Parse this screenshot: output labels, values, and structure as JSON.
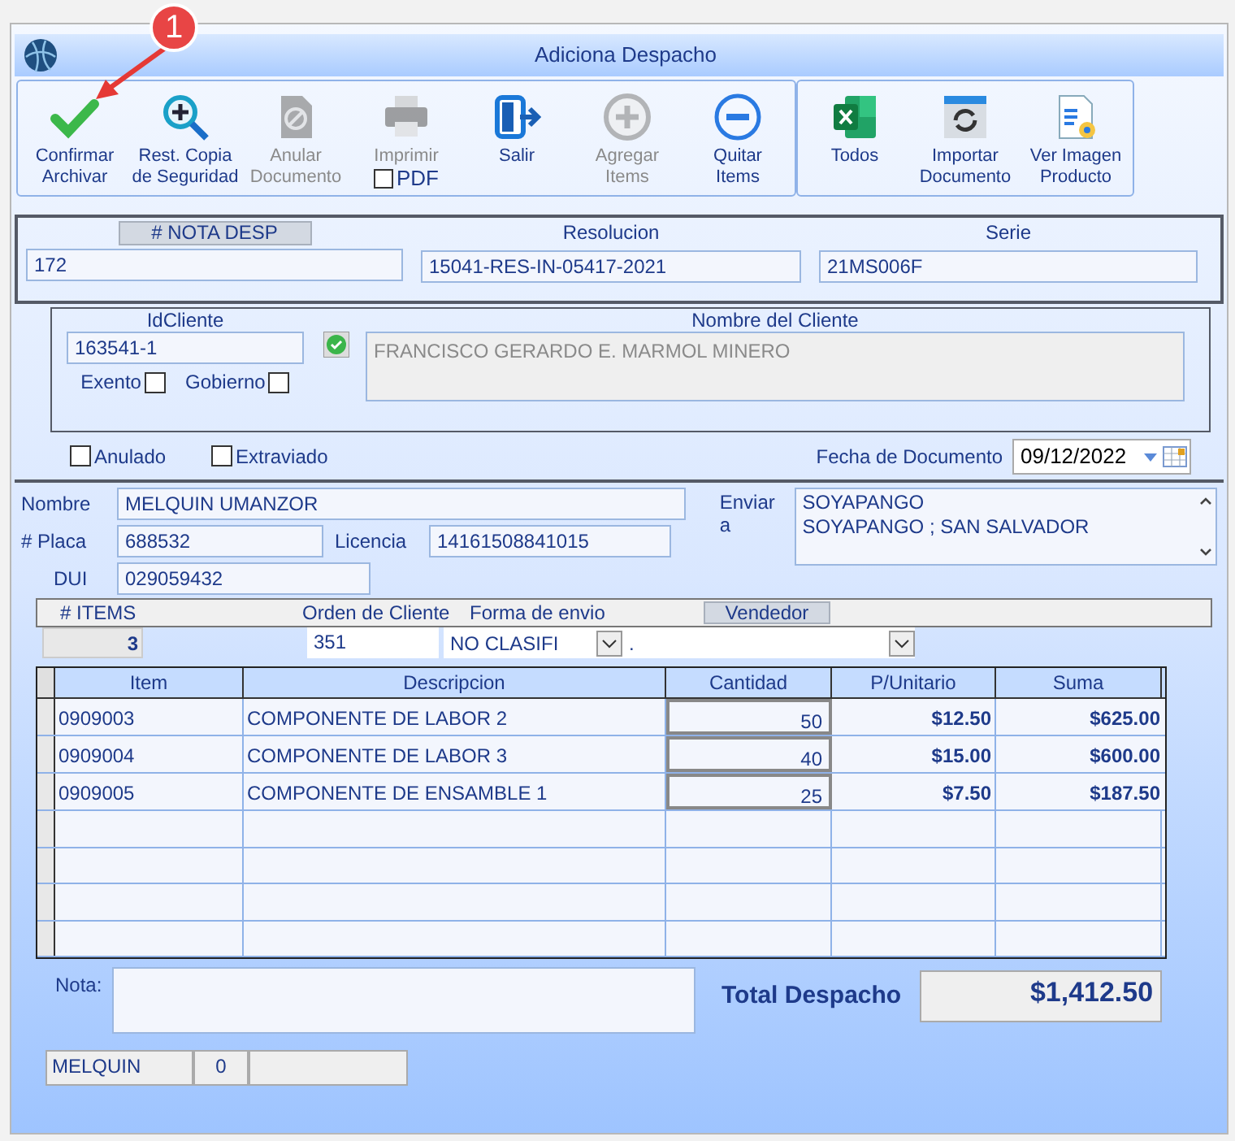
{
  "window": {
    "title": "Adiciona Despacho"
  },
  "callout": {
    "badge": "1"
  },
  "toolbar": {
    "groups": [
      {
        "buttons": [
          {
            "kind": "check",
            "label": "Confirmar\nArchivar",
            "disabled": false
          },
          {
            "kind": "zoom",
            "label": "Rest. Copia\nde Seguridad",
            "disabled": false
          },
          {
            "kind": "void",
            "label": "Anular\nDocumento",
            "disabled": true
          },
          {
            "kind": "print",
            "label": "Imprimir",
            "disabled": true,
            "option": {
              "label": "PDF",
              "checked": false
            }
          },
          {
            "kind": "exit",
            "label": "Salir",
            "disabled": false
          },
          {
            "kind": "add",
            "label": "Agregar\nItems",
            "disabled": true
          },
          {
            "kind": "remove",
            "label": "Quitar\nItems",
            "disabled": false
          }
        ]
      },
      {
        "buttons": [
          {
            "kind": "excel",
            "label": "Todos",
            "disabled": false
          },
          {
            "kind": "import",
            "label": "Importar\nDocumento",
            "disabled": false
          },
          {
            "kind": "invoice",
            "label": "Ver Imagen\nProducto",
            "disabled": false
          }
        ]
      }
    ]
  },
  "document": {
    "number_label": "# NOTA DESP",
    "number": "172",
    "resolution_label": "Resolucion",
    "resolution": "15041-RES-IN-05417-2021",
    "series_label": "Serie",
    "series": "21MS006F"
  },
  "client": {
    "id_label": "IdCliente",
    "id": "163541-1",
    "name_label": "Nombre del Cliente",
    "name": "FRANCISCO GERARDO E. MARMOL MINERO",
    "verified": true,
    "flags": [
      {
        "label": "Exento",
        "checked": false
      },
      {
        "label": "Gobierno",
        "checked": false
      }
    ]
  },
  "status_flags": [
    {
      "label": "Anulado",
      "checked": false
    },
    {
      "label": "Extraviado",
      "checked": false
    }
  ],
  "date": {
    "label": "Fecha de Documento",
    "value": "09/12/2022"
  },
  "transport": {
    "name_label": "Nombre",
    "name": "MELQUIN UMANZOR",
    "plate_label": "# Placa",
    "plate": "688532",
    "license_label": "Licencia",
    "license": "14161508841015",
    "dui_label": "DUI",
    "dui": "029059432",
    "ship_label": "Enviar\na",
    "ship_lines": [
      "SOYAPANGO",
      "SOYAPANGO ; SAN SALVADOR"
    ]
  },
  "items_bar": {
    "count_label": "# ITEMS",
    "count": "3",
    "order_label": "Orden de Cliente",
    "order": "351",
    "shipping_label": "Forma de envio",
    "shipping": "NO CLASIFI",
    "seller_label": "Vendedor",
    "seller": "."
  },
  "table": {
    "columns": [
      "Item",
      "Descripcion",
      "Cantidad",
      "P/Unitario",
      "Suma"
    ],
    "rows": [
      {
        "item": "0909003",
        "description": "COMPONENTE DE LABOR 2",
        "quantity": "50",
        "unit_price": "$12.50",
        "total": "$625.00"
      },
      {
        "item": "0909004",
        "description": "COMPONENTE DE LABOR 3",
        "quantity": "40",
        "unit_price": "$15.00",
        "total": "$600.00"
      },
      {
        "item": "0909005",
        "description": "COMPONENTE DE ENSAMBLE 1",
        "quantity": "25",
        "unit_price": "$7.50",
        "total": "$187.50"
      }
    ]
  },
  "note": {
    "label": "Nota:"
  },
  "total": {
    "label": "Total Despacho",
    "value": "$1,412.50"
  },
  "status_bar": [
    "MELQUIN",
    "0"
  ]
}
